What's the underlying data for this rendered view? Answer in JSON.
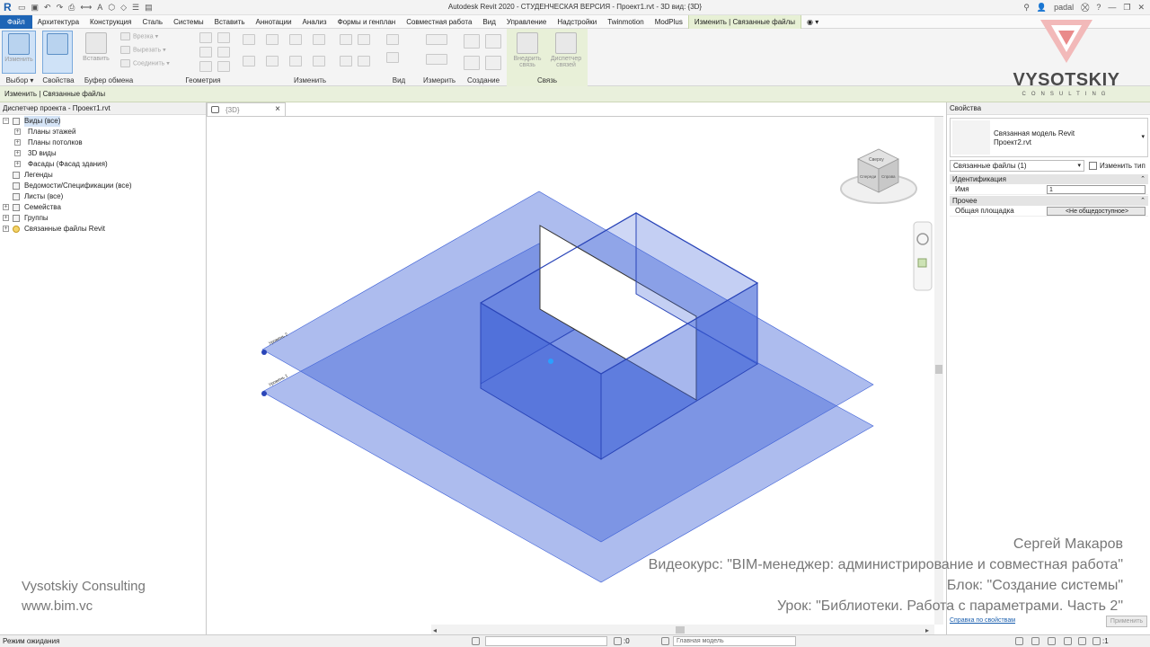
{
  "app": {
    "title": "Autodesk Revit 2020 - СТУДЕНЧЕСКАЯ ВЕРСИЯ - Проект1.rvt - 3D вид: {3D}",
    "logo": "R",
    "user": "padal"
  },
  "tabs": [
    {
      "label": "Файл"
    },
    {
      "label": "Архитектура"
    },
    {
      "label": "Конструкция"
    },
    {
      "label": "Сталь"
    },
    {
      "label": "Системы"
    },
    {
      "label": "Вставить"
    },
    {
      "label": "Аннотации"
    },
    {
      "label": "Анализ"
    },
    {
      "label": "Формы и генплан"
    },
    {
      "label": "Совместная работа"
    },
    {
      "label": "Вид"
    },
    {
      "label": "Управление"
    },
    {
      "label": "Надстройки"
    },
    {
      "label": "Twinmotion"
    },
    {
      "label": "ModPlus"
    },
    {
      "label": "Изменить | Связанные файлы"
    }
  ],
  "ribbon": {
    "modify_label": "Изменить",
    "paste_label": "Вставить",
    "cut_label": "Врезка",
    "cutout_label": "Вырезать",
    "join_label": "Соединить",
    "embed_label": "Внедрить связь",
    "manager_label": "Диспетчер связей",
    "groups": {
      "select": "Выбор",
      "properties": "Свойства",
      "clipboard": "Буфер обмена",
      "geometry": "Геометрия",
      "modify": "Изменить",
      "view": "Вид",
      "measure": "Измерить",
      "create": "Создание",
      "link": "Связь"
    }
  },
  "optbar": {
    "label": "Изменить | Связанные файлы"
  },
  "browser": {
    "title": "Диспетчер проекта - Проект1.rvt",
    "items": [
      {
        "label": "Виды (все)"
      },
      {
        "label": "Планы этажей"
      },
      {
        "label": "Планы потолков"
      },
      {
        "label": "3D виды"
      },
      {
        "label": "Фасады (Фасад здания)"
      },
      {
        "label": "Легенды"
      },
      {
        "label": "Ведомости/Спецификации (все)"
      },
      {
        "label": "Листы (все)"
      },
      {
        "label": "Семейства"
      },
      {
        "label": "Группы"
      },
      {
        "label": "Связанные файлы Revit"
      }
    ]
  },
  "view": {
    "tab_label": "{3D}",
    "level1": "Уровень 1",
    "level2": "Уровень 2",
    "cube_top": "Сверху",
    "cube_front": "Спереди",
    "cube_right": "Справа"
  },
  "properties": {
    "title": "Свойства",
    "type_name_line1": "Связанная модель Revit",
    "type_name_line2": "Проект2.rvt",
    "filter": "Связанные файлы (1)",
    "edit_type": "Изменить тип",
    "sections": {
      "identification": "Идентификация",
      "other": "Прочее"
    },
    "rows": {
      "name_key": "Имя",
      "name_val": "1",
      "shared_key": "Общая площадка",
      "shared_val": "<Не общедоступное>"
    },
    "help_link": "Справка по свойствам",
    "apply": "Применить"
  },
  "status": {
    "text": "Режим ожидания",
    "count": ":0",
    "model": "Главная модель",
    "filter_count": ":1"
  },
  "brand": {
    "name": "VYSOTSKIY",
    "sub": "CONSULTING",
    "company": "Vysotskiy Consulting",
    "site": "www.bim.vc"
  },
  "course": {
    "author": "Сергей Макаров",
    "course": "Видеокурс: \"BIM-менеджер: администрирование и совместная работа\"",
    "block": "Блок: \"Создание системы\"",
    "lesson": "Урок: \"Библиотеки. Работа с параметрами. Часть 2\""
  },
  "colors": {
    "accent": "#1e65b6",
    "model_blue": "#3c5fd6",
    "link_tab": "#e7f0d5"
  }
}
